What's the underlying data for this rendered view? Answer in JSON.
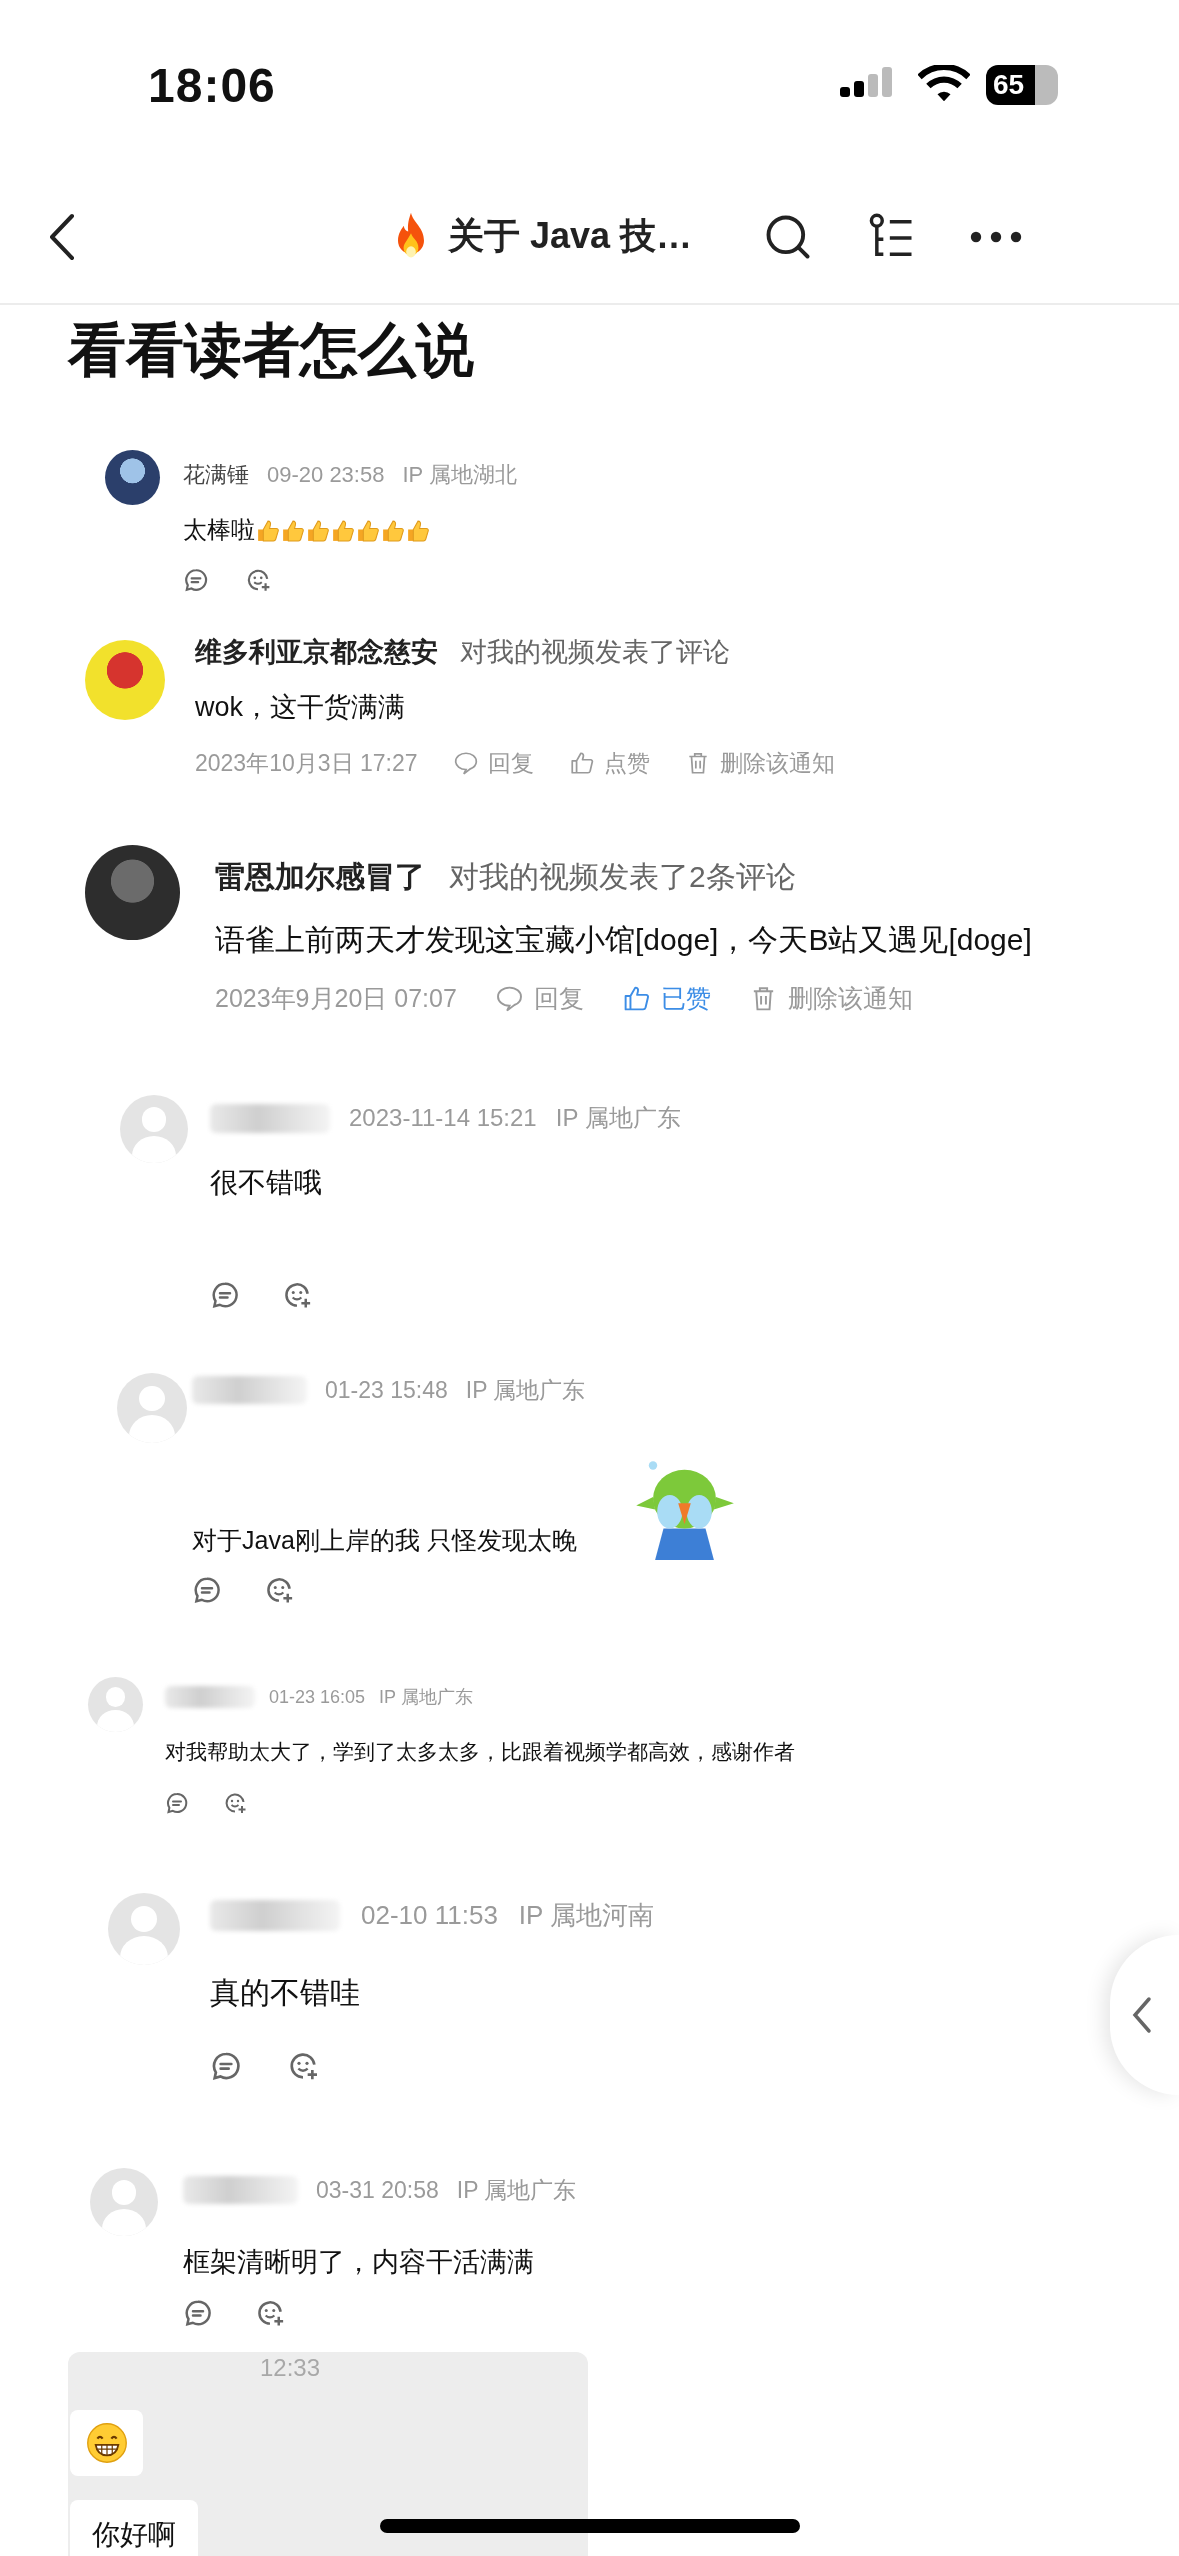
{
  "status_bar": {
    "time": "18:06",
    "battery": "65"
  },
  "nav_bar": {
    "title": "关于 Java 技…"
  },
  "heading": "看看读者怎么说",
  "comments": [
    {
      "kind": "comment",
      "name": "花满锤",
      "time": "09-20 23:58",
      "location": "IP 属地湖北",
      "text": "太棒啦"
    },
    {
      "kind": "notification",
      "name": "维多利亚京都念慈安",
      "action": "对我的视频发表了评论",
      "text": "wok，这干货满满",
      "date": "2023年10月3日 17:27",
      "reply": "回复",
      "like": "点赞",
      "liked": false,
      "delete": "删除该通知"
    },
    {
      "kind": "notification",
      "name": "雷恩加尔感冒了",
      "action": "对我的视频发表了2条评论",
      "text": "语雀上前两天才发现这宝藏小馆[doge]，今天B站又遇见[doge]",
      "date": "2023年9月20日 07:07",
      "reply": "回复",
      "like": "已赞",
      "liked": true,
      "delete": "删除该通知"
    },
    {
      "kind": "comment",
      "time": "2023-11-14 15:21",
      "location": "IP 属地广东",
      "text": "很不错哦"
    },
    {
      "kind": "comment",
      "time": "01-23 15:48",
      "location": "IP 属地广东",
      "text": "对于Java刚上岸的我 只怪发现太晚"
    },
    {
      "kind": "comment",
      "time": "01-23 16:05",
      "location": "IP 属地广东",
      "text": "对我帮助太大了，学到了太多太多，比跟着视频学都高效，感谢作者"
    },
    {
      "kind": "comment",
      "time": "02-10 11:53",
      "location": "IP 属地河南",
      "text": "真的不错哇"
    },
    {
      "kind": "comment",
      "time": "03-31 20:58",
      "location": "IP 属地广东",
      "text": "框架清晰明了，内容干活满满"
    }
  ],
  "chat": {
    "time": "12:33",
    "messages": [
      {
        "kind": "emoji"
      },
      {
        "kind": "text",
        "text": "你好啊"
      }
    ]
  }
}
